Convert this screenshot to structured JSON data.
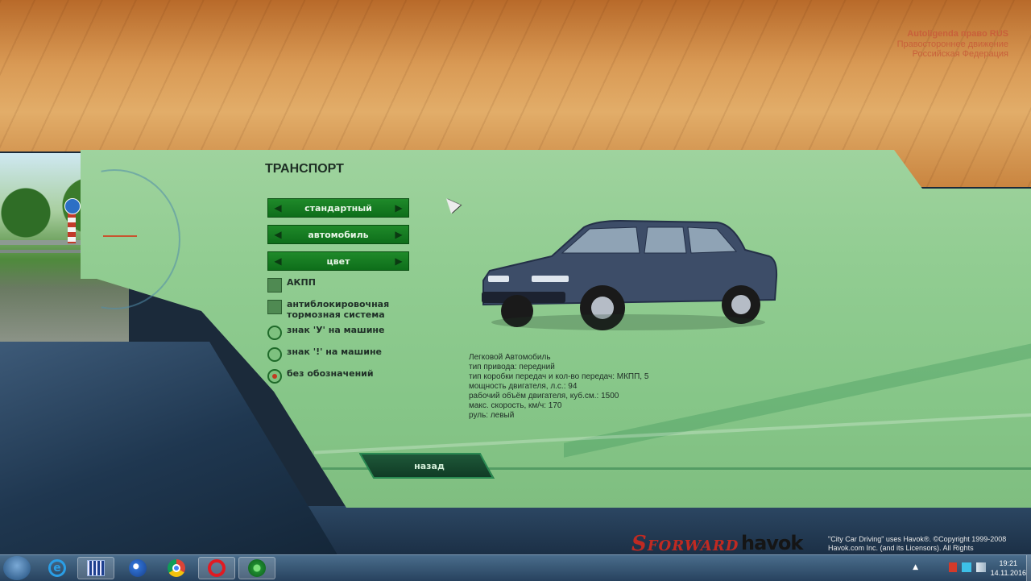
{
  "region": {
    "line1": "Autoligenda право  RUS",
    "line2": "Правостороннее движение",
    "line3": "Российская Федерация"
  },
  "section_title": "ТРАНСПОРТ",
  "selectors": [
    {
      "label": "стандартный"
    },
    {
      "label": "автомобиль"
    },
    {
      "label": "цвет"
    }
  ],
  "options": {
    "checkboxes": [
      {
        "label": "АКПП",
        "checked": false
      },
      {
        "label": "антиблокировочная тормозная система",
        "checked": false
      }
    ],
    "radios": [
      {
        "label": "знак 'У' на машине",
        "selected": false
      },
      {
        "label": "знак '!' на машине",
        "selected": false
      },
      {
        "label": "без обозначений",
        "selected": true
      }
    ]
  },
  "specs": {
    "type": "Легковой Автомобиль",
    "drive": "тип привода:  передний",
    "gearbox": "тип коробки передач и кол-во передач:  МКПП, 5",
    "power": "мощность двигателя, л.с.:  94",
    "displacement": "рабочий объём двигателя, куб.см.:  1500",
    "max_speed": "макс. скорость, км/ч:  170",
    "steering": "руль: левый"
  },
  "back_button": "назад",
  "logos": {
    "forward": "FORWARD",
    "havok": "havok"
  },
  "copyright": {
    "line1": "\"City Car Driving\" uses Havok®. ©Copyright 1999-2008",
    "line2": "Havok.com Inc. (and its Licensors). All Rights"
  },
  "taskbar": {
    "time": "19:21",
    "date": "14.11.2016",
    "apps": [
      "internet-explorer",
      "media-folder",
      "windows-media-player",
      "chrome",
      "opera",
      "city-car-driving"
    ]
  },
  "colors": {
    "panel_green": "#92cd92",
    "button_green": "#1f8a2a",
    "banner_orange": "#d99a55",
    "radio_selected": "#c23a22"
  }
}
